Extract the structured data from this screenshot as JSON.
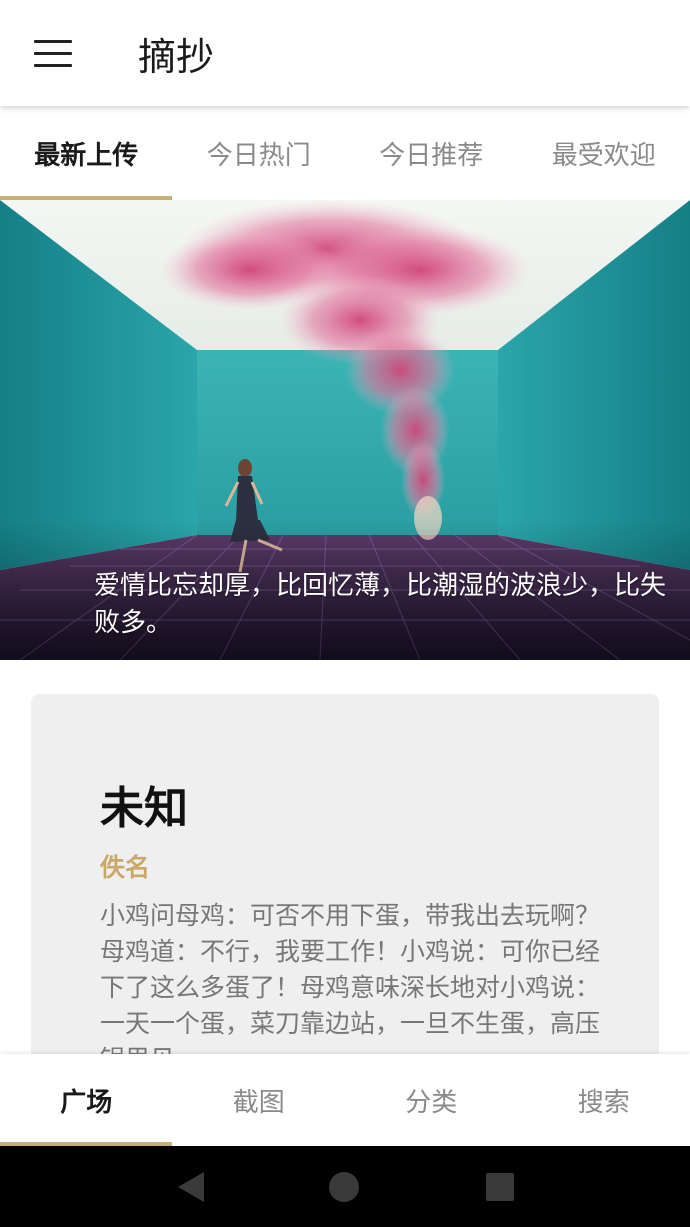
{
  "app_bar": {
    "title": "摘抄",
    "menu_icon": "menu-icon"
  },
  "top_tabs": [
    {
      "label": "最新上传",
      "active": true
    },
    {
      "label": "今日热门",
      "active": false
    },
    {
      "label": "今日推荐",
      "active": false
    },
    {
      "label": "最受欢迎",
      "active": false
    }
  ],
  "hero": {
    "caption": "爱情比忘却厚，比回忆薄，比潮湿的波浪少，比失败多。"
  },
  "card": {
    "title": "未知",
    "author": "佚名",
    "body": "小鸡问母鸡：可否不用下蛋，带我出去玩啊？母鸡道：不行，我要工作！小鸡说：可你已经下了这么多蛋了！母鸡意味深长地对小鸡说：一天一个蛋，菜刀靠边站，一旦不生蛋，高压锅里见。"
  },
  "bottom_nav": [
    {
      "label": "广场",
      "active": true
    },
    {
      "label": "截图",
      "active": false
    },
    {
      "label": "分类",
      "active": false
    },
    {
      "label": "搜索",
      "active": false
    }
  ],
  "system_nav": {
    "back_icon": "back-triangle-icon",
    "home_icon": "home-circle-icon",
    "recent_icon": "recent-square-icon"
  },
  "colors": {
    "accent": "#c7b078",
    "author": "#c9a86a",
    "card_bg": "#efefef",
    "room_teal": "#1f9ea3"
  }
}
